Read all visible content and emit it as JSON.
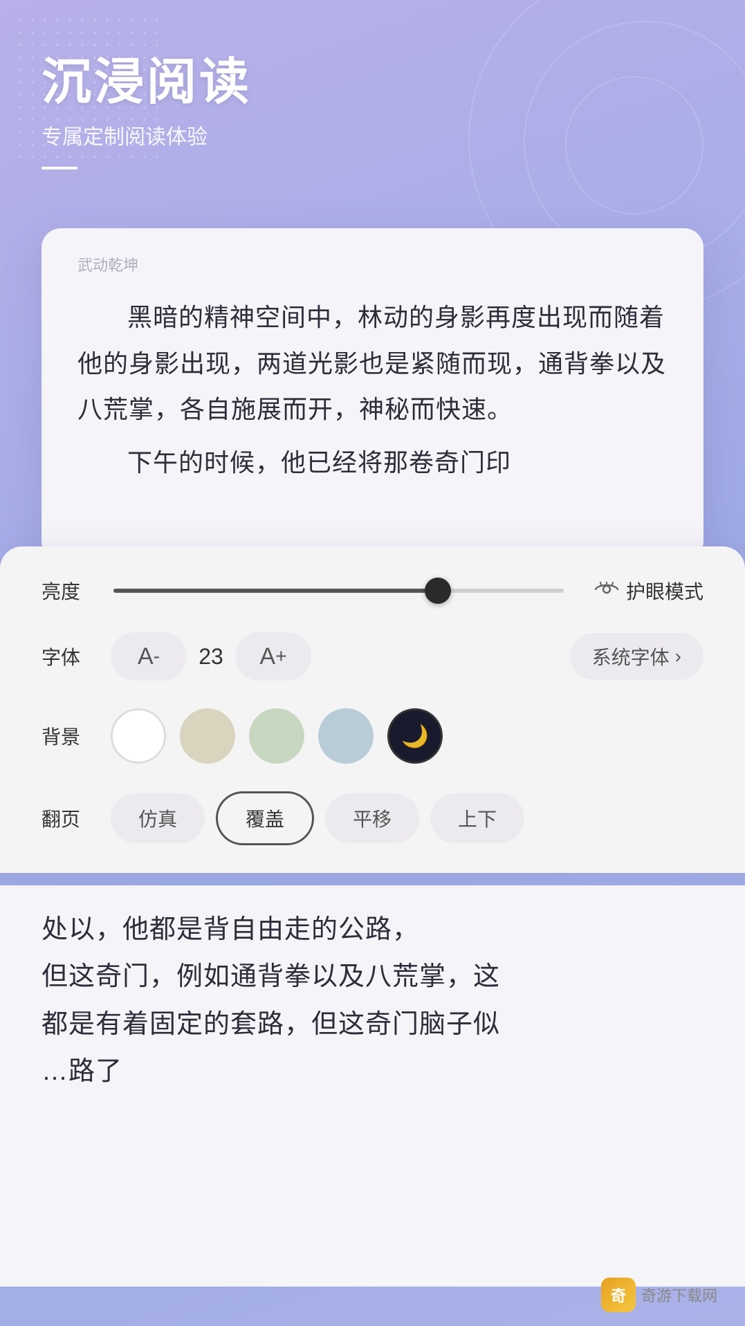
{
  "hero": {
    "title": "沉浸阅读",
    "subtitle": "专属定制阅读体验"
  },
  "reading_card": {
    "book_title": "武动乾坤",
    "paragraph1": "黑暗的精神空间中，林动的身影再度出现而随着他的身影出现，两道光影也是紧随而现，通背拳以及八荒掌，各自施展而开，神秘而快速。",
    "paragraph2": "下午的时候，他已经将那卷奇门印"
  },
  "settings": {
    "brightness_label": "亮度",
    "brightness_value": 72,
    "eye_mode_label": "护眼模式",
    "font_label": "字体",
    "font_decrease": "A⁻",
    "font_size": "23",
    "font_increase": "A⁺",
    "font_family": "系统字体",
    "bg_label": "背景",
    "page_label": "翻页",
    "page_options": [
      "仿真",
      "覆盖",
      "平移",
      "上下"
    ],
    "page_active": "覆盖"
  },
  "bottom_reading": {
    "line1": "处以，他都是背自由走的公路，",
    "line2": "但这奇门，例如通背拳以及八荒掌，这",
    "line3": "都是有着固定的套路，但这奇门脑子似",
    "line4": "…路了"
  },
  "watermark": {
    "logo": "奇",
    "text": "奇游下载网"
  }
}
